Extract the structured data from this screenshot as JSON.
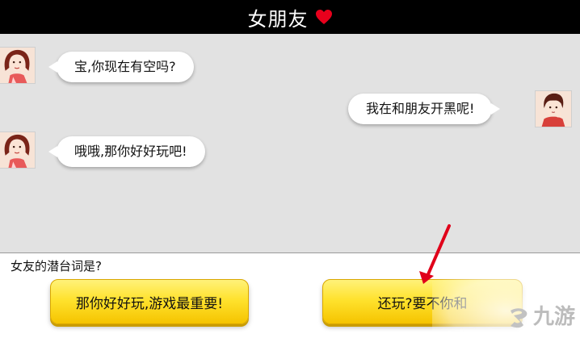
{
  "header": {
    "title": "女朋友",
    "heart_color": "#e8001c"
  },
  "chat": {
    "messages": [
      {
        "side": "left",
        "sender": "girlfriend",
        "text": "宝,你现在有空吗?"
      },
      {
        "side": "right",
        "sender": "player",
        "text": "我在和朋友开黑呢!"
      },
      {
        "side": "left",
        "sender": "girlfriend",
        "text": "哦哦,那你好好玩吧!"
      }
    ]
  },
  "question": {
    "prompt": "女友的潜台词是?",
    "choices": [
      {
        "label": "那你好好玩,游戏最重要!"
      },
      {
        "label": "还玩?要不你和"
      }
    ]
  },
  "annotation": {
    "arrow_color": "#e0001a"
  },
  "watermark": {
    "text": "九游",
    "icon": "jiuyou-logo-icon"
  }
}
